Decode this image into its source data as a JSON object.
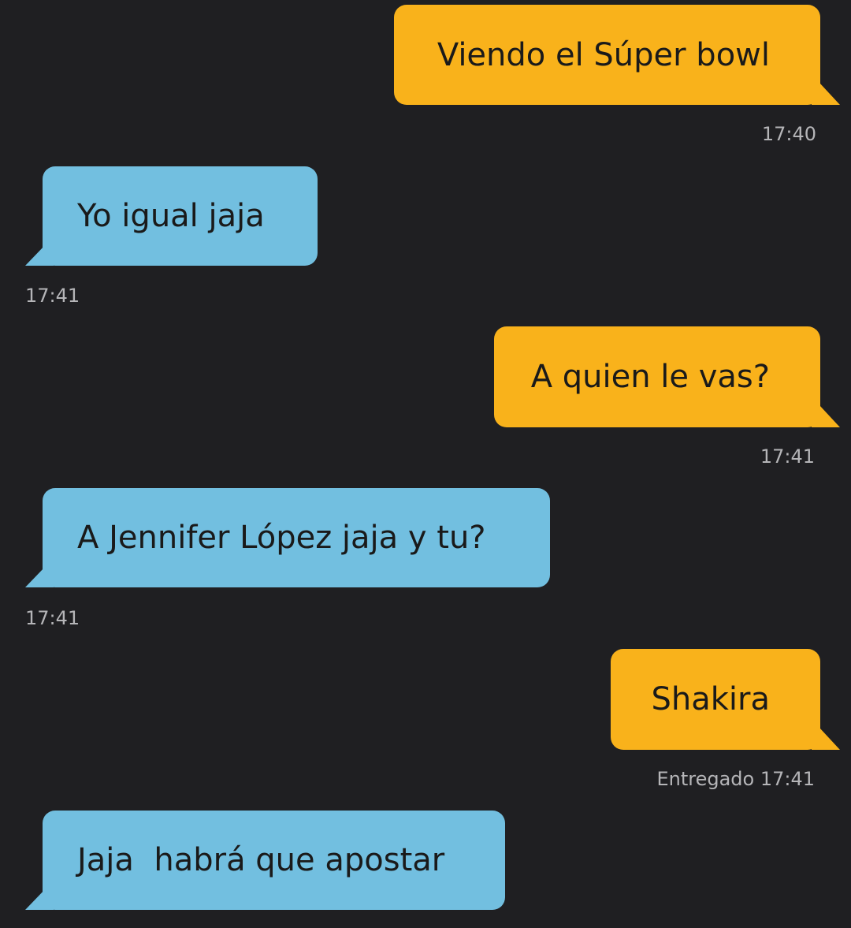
{
  "messages": [
    {
      "direction": "out",
      "text": "Viendo el Súper bowl",
      "status": "",
      "time": "17:40"
    },
    {
      "direction": "in",
      "text": "Yo igual jaja",
      "status": "",
      "time": "17:41"
    },
    {
      "direction": "out",
      "text": "A quien le vas?",
      "status": "",
      "time": "17:41"
    },
    {
      "direction": "in",
      "text": "A Jennifer López jaja y tu?",
      "status": "",
      "time": "17:41"
    },
    {
      "direction": "out",
      "text": "Shakira",
      "status": "Entregado",
      "time": "17:41"
    },
    {
      "direction": "in",
      "text": "Jaja  habrá que apostar",
      "status": "",
      "time": ""
    }
  ],
  "colors": {
    "background": "#1f1f22",
    "outgoing_bubble": "#f9b21b",
    "incoming_bubble": "#72bfe0",
    "timestamp": "#b5b5b8"
  }
}
